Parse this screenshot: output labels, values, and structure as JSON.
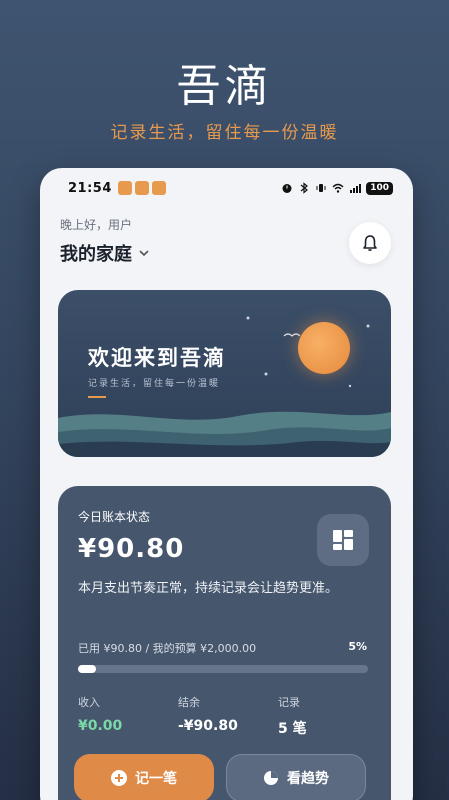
{
  "hero": {
    "title": "吾滴",
    "subtitle": "记录生活，留住每一份温暖"
  },
  "status_bar": {
    "time": "21:54",
    "battery": "100"
  },
  "header": {
    "greeting": "晚上好，用户",
    "family_name": "我的家庭"
  },
  "banner": {
    "title": "欢迎来到吾滴",
    "subtitle": "记录生活，留住每一份温暖"
  },
  "ledger": {
    "label": "今日账本状态",
    "amount": "¥90.80",
    "message": "本月支出节奏正常，持续记录会让趋势更准。",
    "budget_text": "已用 ¥90.80 / 我的预算 ¥2,000.00",
    "percent_text": "5%",
    "progress_fraction": 0.05,
    "stats": [
      {
        "label": "收入",
        "value": "¥0.00"
      },
      {
        "label": "结余",
        "value": "-¥90.80"
      },
      {
        "label": "记录",
        "value": "5 笔"
      }
    ],
    "primary_button": "记一笔",
    "secondary_button": "看趋势"
  },
  "colors": {
    "accent": "#e08a47",
    "income": "#7bd6a8",
    "card": "#46566d"
  }
}
